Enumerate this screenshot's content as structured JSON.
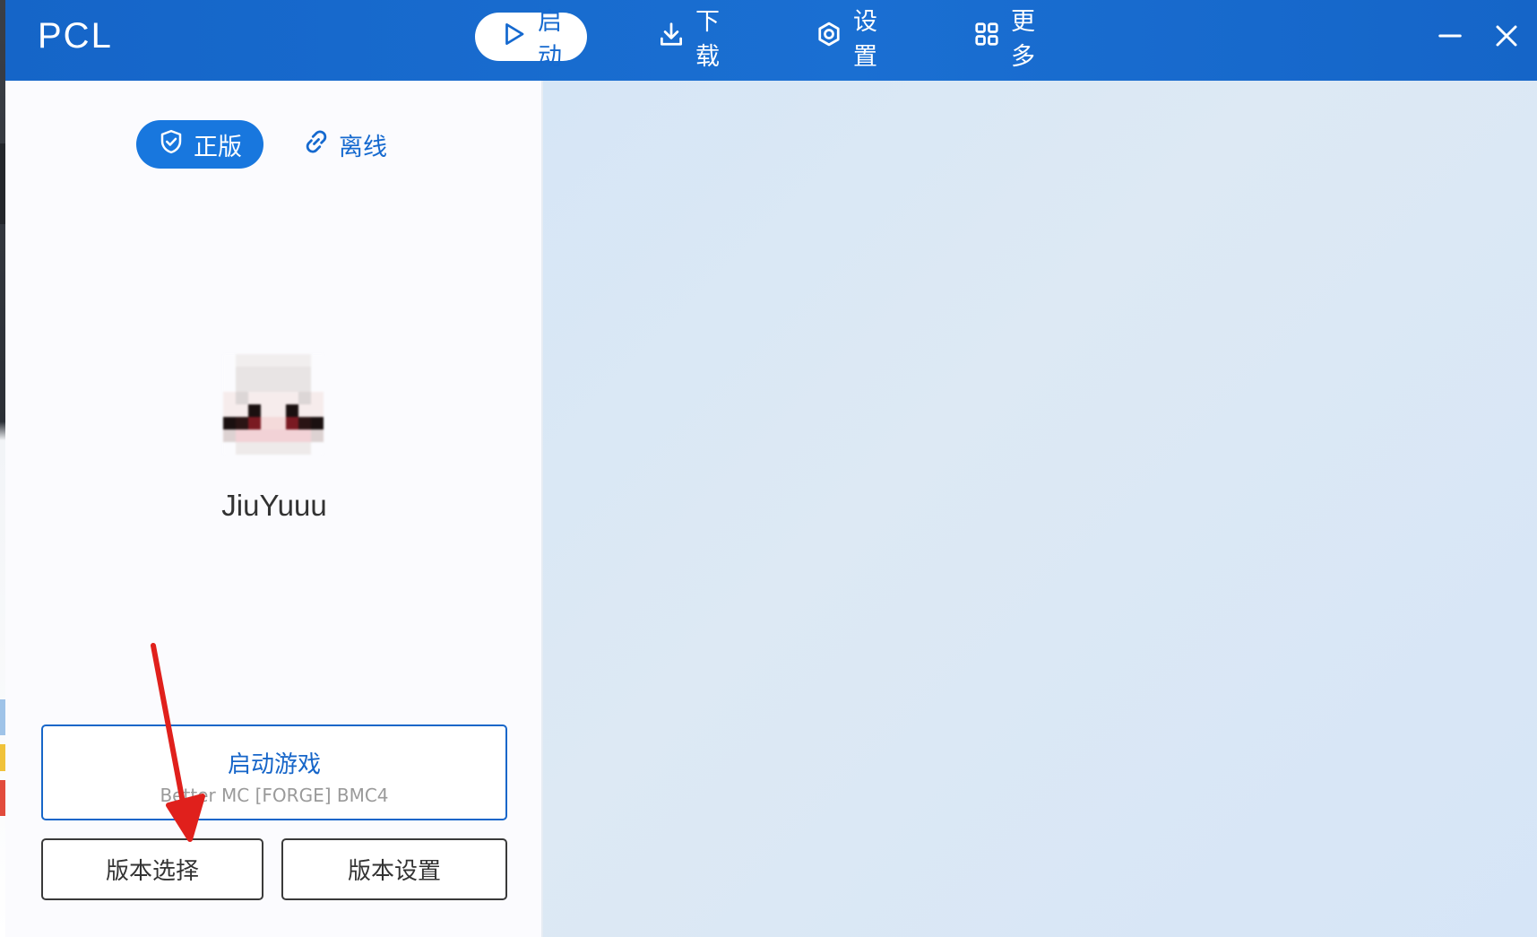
{
  "app": {
    "logo": "PCL"
  },
  "nav": {
    "items": [
      {
        "label": "启动",
        "icon": "play-icon",
        "active": true
      },
      {
        "label": "下载",
        "icon": "download-icon",
        "active": false
      },
      {
        "label": "设置",
        "icon": "settings-icon",
        "active": false
      },
      {
        "label": "更多",
        "icon": "grid-icon",
        "active": false
      }
    ]
  },
  "window_controls": {
    "minimize_icon": "minimize-icon",
    "close_icon": "close-icon"
  },
  "account": {
    "tabs": [
      {
        "label": "正版",
        "icon": "shield-check-icon",
        "active": true
      },
      {
        "label": "离线",
        "icon": "link-icon",
        "active": false
      }
    ],
    "username": "JiuYuuu"
  },
  "launch": {
    "title": "启动游戏",
    "version": "Better MC [FORGE] BMC4"
  },
  "buttons": {
    "version_select": "版本选择",
    "version_settings": "版本设置"
  },
  "colors": {
    "titlebar": "#1565c8",
    "accent": "#1569cf",
    "annotation_arrow": "#e0201c"
  }
}
